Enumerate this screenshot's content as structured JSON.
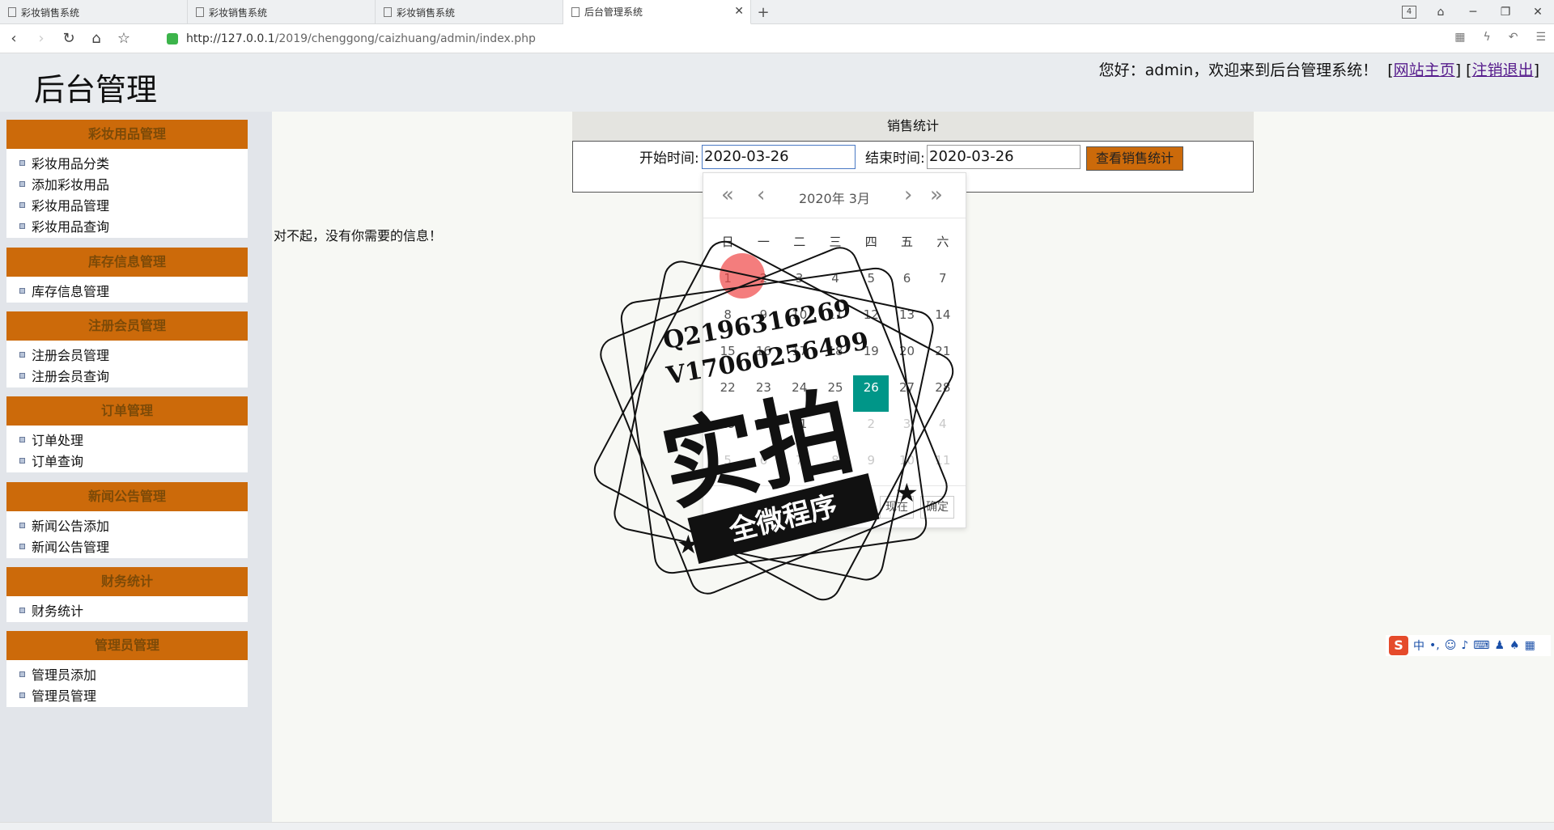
{
  "browser": {
    "tabs": [
      {
        "title": "彩妆销售系统",
        "active": false
      },
      {
        "title": "彩妆销售系统",
        "active": false
      },
      {
        "title": "彩妆销售系统",
        "active": false
      },
      {
        "title": "后台管理系统",
        "active": true
      }
    ],
    "tab_count": "4",
    "url_host": "http://127.0.0.1",
    "url_path": "/2019/chenggong/caizhuang/admin/index.php"
  },
  "header": {
    "title": "后台管理",
    "welcome": "您好：admin，欢迎来到后台管理系统！",
    "home_link": "网站主页",
    "logout_link": "注销退出"
  },
  "sidebar": {
    "groups": [
      {
        "title": "彩妆用品管理",
        "items": [
          "彩妆用品分类",
          "添加彩妆用品",
          "彩妆用品管理",
          "彩妆用品查询"
        ]
      },
      {
        "title": "库存信息管理",
        "items": [
          "库存信息管理"
        ]
      },
      {
        "title": "注册会员管理",
        "items": [
          "注册会员管理",
          "注册会员查询"
        ]
      },
      {
        "title": "订单管理",
        "items": [
          "订单处理",
          "订单查询"
        ]
      },
      {
        "title": "新闻公告管理",
        "items": [
          "新闻公告添加",
          "新闻公告管理"
        ]
      },
      {
        "title": "财务统计",
        "items": [
          "财务统计"
        ]
      },
      {
        "title": "管理员管理",
        "items": [
          "管理员添加",
          "管理员管理"
        ]
      }
    ]
  },
  "stats": {
    "title": "销售统计",
    "start_label": "开始时间:",
    "start_value": "2020-03-26",
    "end_label": "结束时间:",
    "end_value": "2020-03-26",
    "query_button": "查看销售统计",
    "no_info": "对不起，没有你需要的信息！"
  },
  "calendar": {
    "year_month": "2020年  3月",
    "weekdays": [
      "日",
      "一",
      "二",
      "三",
      "四",
      "五",
      "六"
    ],
    "rows": [
      [
        "1",
        "2",
        "3",
        "4",
        "5",
        "6",
        "7"
      ],
      [
        "8",
        "9",
        "10",
        "11",
        "12",
        "13",
        "14"
      ],
      [
        "15",
        "16",
        "17",
        "18",
        "19",
        "20",
        "21"
      ],
      [
        "22",
        "23",
        "24",
        "25",
        "26",
        "27",
        "28"
      ],
      [
        "29",
        "30",
        "31",
        "1",
        "2",
        "3",
        "4"
      ],
      [
        "5",
        "6",
        "7",
        "8",
        "9",
        "10",
        "11"
      ]
    ],
    "selected": "26",
    "now_button": "现在",
    "confirm_button": "确定"
  },
  "watermark": {
    "line1": "Q2196316269",
    "line2": "V17060256499",
    "big": "实拍",
    "ribbon": "全微程序"
  },
  "ime": {
    "logo": "S",
    "mode": "中"
  }
}
